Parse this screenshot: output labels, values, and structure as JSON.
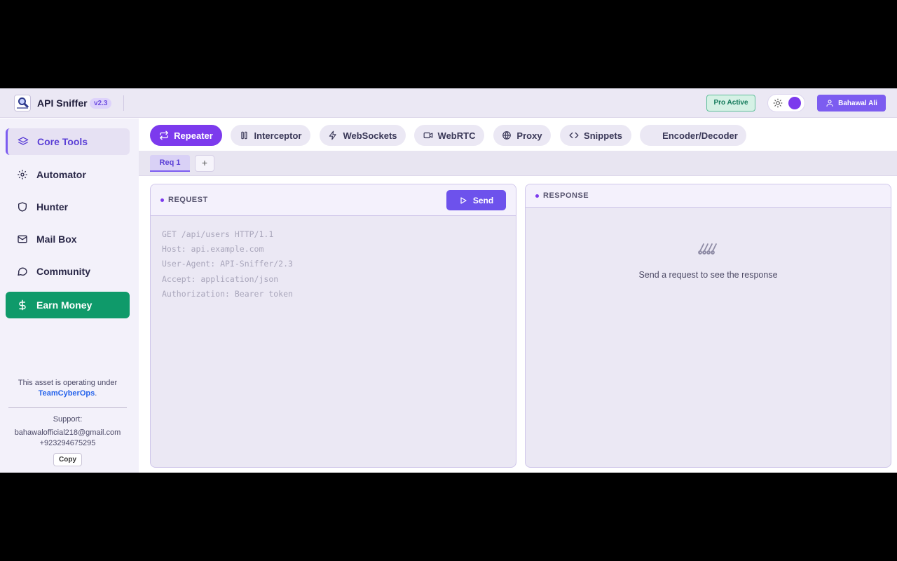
{
  "header": {
    "app_title": "API Sniffer",
    "version": "v2.3",
    "pro_badge": "Pro Active",
    "user_name": "Bahawal Ali"
  },
  "sidebar": {
    "items": [
      {
        "label": "Core Tools",
        "icon": "layers-icon",
        "active": true
      },
      {
        "label": "Automator",
        "icon": "gear-icon"
      },
      {
        "label": "Hunter",
        "icon": "shield-icon"
      },
      {
        "label": "Mail Box",
        "icon": "mail-icon"
      },
      {
        "label": "Community",
        "icon": "chat-bubble-icon"
      },
      {
        "label": "Earn Money",
        "icon": "dollar-icon"
      }
    ],
    "footer": {
      "operating_text": "This asset is operating under",
      "team_name": "TeamCyberOps",
      "team_suffix": ".",
      "support_label": "Support:",
      "email": "bahawalofficial218@gmail.com",
      "phone": "+923294675295",
      "copy_label": "Copy"
    }
  },
  "tools": {
    "tabs": [
      {
        "label": "Repeater",
        "icon": "repeat-icon",
        "active": true
      },
      {
        "label": "Interceptor",
        "icon": "columns-icon"
      },
      {
        "label": "WebSockets",
        "icon": "lightning-icon"
      },
      {
        "label": "WebRTC",
        "icon": "video-icon"
      },
      {
        "label": "Proxy",
        "icon": "globe-icon"
      },
      {
        "label": "Snippets",
        "icon": "code-icon"
      },
      {
        "label": "Encoder/Decoder",
        "icon": ""
      }
    ]
  },
  "request_tabs": {
    "items": [
      {
        "label": "Req 1",
        "active": true
      }
    ],
    "add_label": "+"
  },
  "request_panel": {
    "title": "REQUEST",
    "send_label": "Send",
    "body_placeholder": "GET /api/users HTTP/1.1\nHost: api.example.com\nUser-Agent: API-Sniffer/2.3\nAccept: application/json\nAuthorization: Bearer token"
  },
  "response_panel": {
    "title": "RESPONSE",
    "empty_text": "Send a request to see the response",
    "empty_icon": "signal-waves-icon"
  },
  "colors": {
    "accent": "#7c3aed",
    "earn": "#0f9a6a",
    "pro": "#13795a"
  }
}
